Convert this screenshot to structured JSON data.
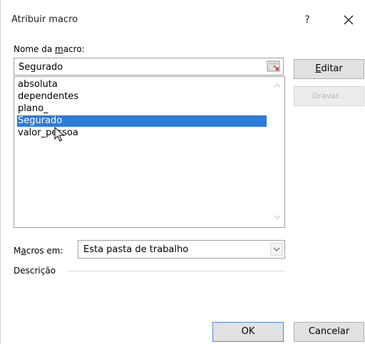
{
  "window": {
    "title": "Atribuir macro",
    "help_label": "?"
  },
  "macro_name": {
    "label_before": "Nome da ",
    "label_underlined": "m",
    "label_after": "acro:",
    "value": "Segurado"
  },
  "macro_list": {
    "items": [
      "absoluta",
      "dependentes",
      "plano_",
      "Segurado",
      "valor_pessoa"
    ],
    "selected_index": 3
  },
  "buttons": {
    "editar_underlined": "E",
    "editar_rest": "ditar",
    "gravar": "Gravar...",
    "ok": "OK",
    "cancelar": "Cancelar"
  },
  "macros_em": {
    "label_before": "M",
    "label_underlined": "a",
    "label_after": "cros em:",
    "value": "Esta pasta de trabalho"
  },
  "descricao": {
    "label": "Descrição"
  },
  "colors": {
    "selection": "#2f7bd8",
    "button_face": "#e1e1e1",
    "border": "#a0a0a0"
  }
}
